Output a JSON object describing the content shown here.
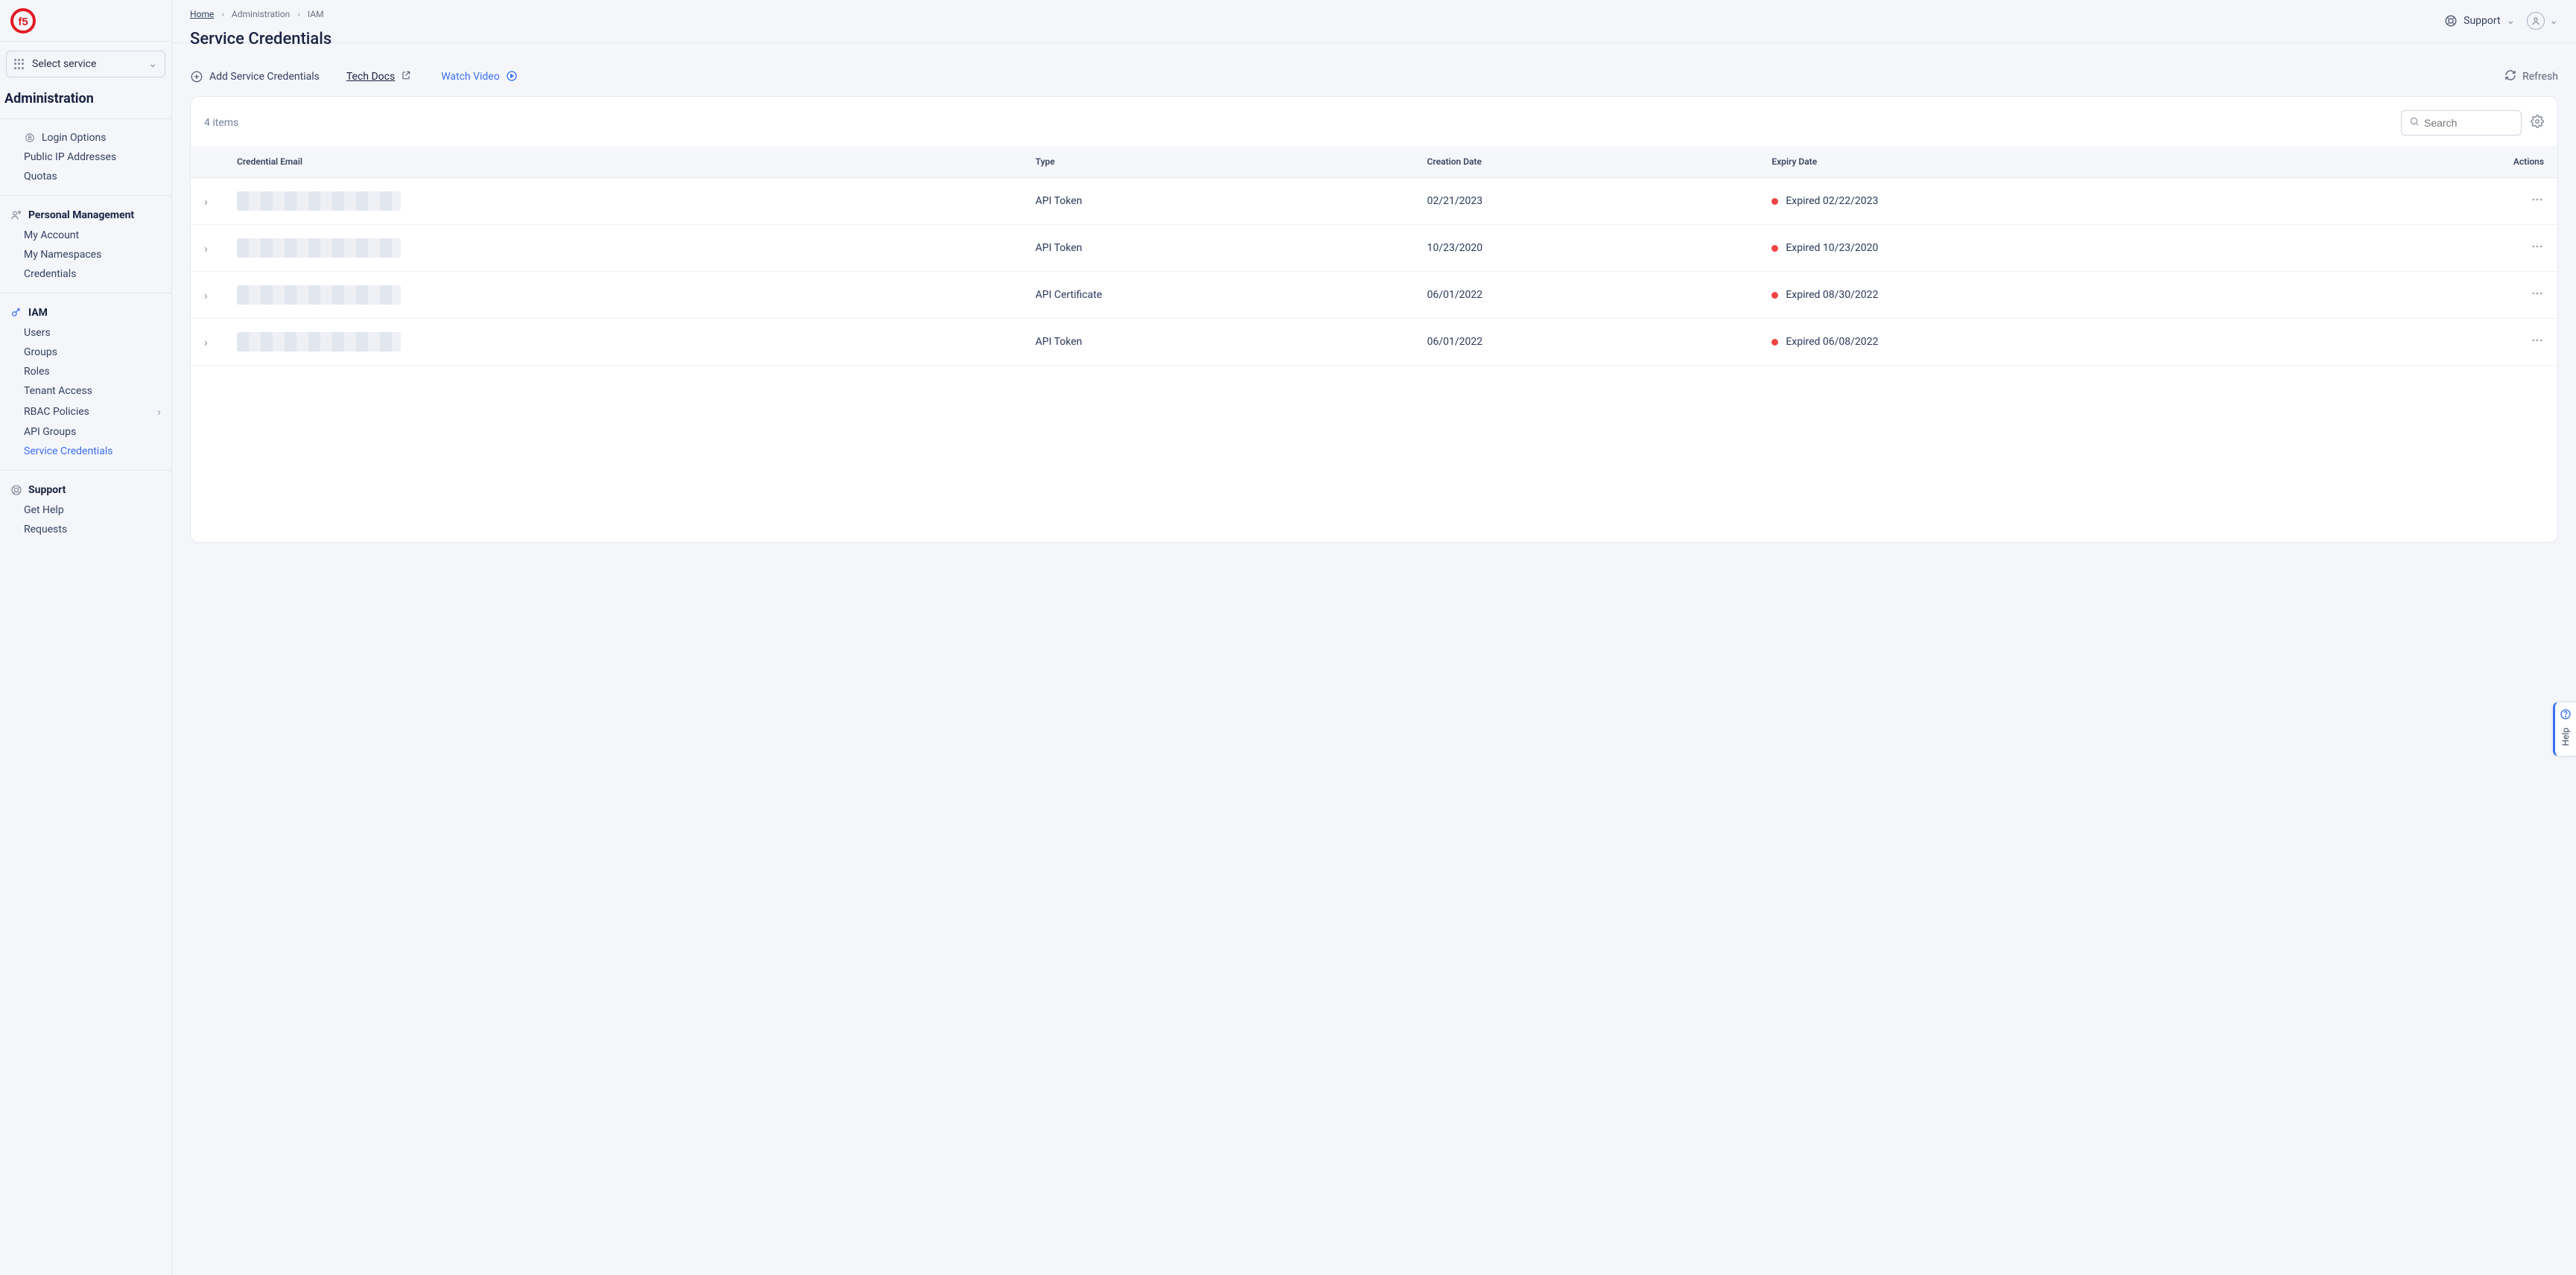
{
  "sidebar": {
    "select_service": "Select service",
    "section_title": "Administration",
    "group_general": {
      "items": [
        {
          "label": "Login Options",
          "icon": "lock"
        },
        {
          "label": "Public IP Addresses"
        },
        {
          "label": "Quotas"
        }
      ]
    },
    "group_personal": {
      "title": "Personal Management",
      "items": [
        {
          "label": "My Account"
        },
        {
          "label": "My Namespaces"
        },
        {
          "label": "Credentials"
        }
      ]
    },
    "group_iam": {
      "title": "IAM",
      "items": [
        {
          "label": "Users"
        },
        {
          "label": "Groups"
        },
        {
          "label": "Roles"
        },
        {
          "label": "Tenant Access"
        },
        {
          "label": "RBAC Policies",
          "chevron": true
        },
        {
          "label": "API Groups"
        },
        {
          "label": "Service Credentials",
          "active": true
        }
      ]
    },
    "group_support": {
      "title": "Support",
      "items": [
        {
          "label": "Get Help"
        },
        {
          "label": "Requests"
        }
      ]
    }
  },
  "breadcrumb": {
    "home": "Home",
    "seg1": "Administration",
    "seg2": "IAM"
  },
  "page_title": "Service Credentials",
  "top_right": {
    "support": "Support"
  },
  "actions": {
    "add": "Add Service Credentials",
    "docs": "Tech Docs",
    "video": "Watch Video",
    "refresh": "Refresh"
  },
  "table": {
    "count_label": "4 items",
    "search_placeholder": "Search",
    "columns": {
      "email": "Credential Email",
      "type": "Type",
      "created": "Creation Date",
      "expiry": "Expiry Date",
      "actions": "Actions"
    },
    "rows": [
      {
        "type": "API Token",
        "created": "02/21/2023",
        "expiry": "Expired 02/22/2023"
      },
      {
        "type": "API Token",
        "created": "10/23/2020",
        "expiry": "Expired 10/23/2020"
      },
      {
        "type": "API Certificate",
        "created": "06/01/2022",
        "expiry": "Expired 08/30/2022"
      },
      {
        "type": "API Token",
        "created": "06/01/2022",
        "expiry": "Expired 06/08/2022"
      }
    ]
  },
  "help_tab": "Help"
}
